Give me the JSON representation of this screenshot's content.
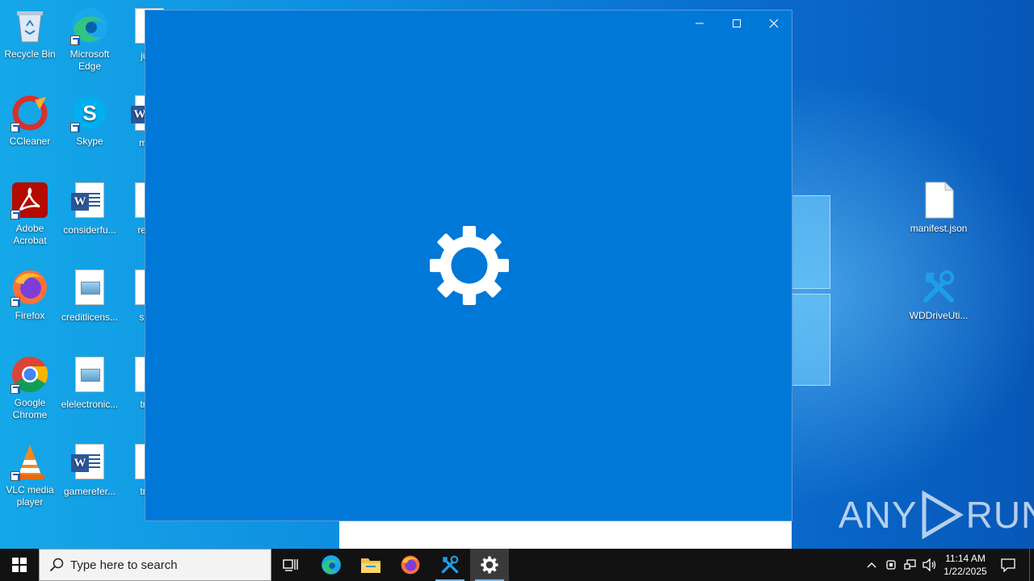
{
  "desktop": {
    "icons_left": [
      {
        "label": "Recycle Bin",
        "icon": "recycle-bin-icon"
      },
      {
        "label": "CCleaner",
        "icon": "ccleaner-icon"
      },
      {
        "label": "Adobe Acrobat",
        "icon": "acrobat-icon"
      },
      {
        "label": "Firefox",
        "icon": "firefox-icon"
      },
      {
        "label": "Google Chrome",
        "icon": "chrome-icon"
      },
      {
        "label": "VLC media player",
        "icon": "vlc-icon"
      }
    ],
    "icons_col2": [
      {
        "label": "Microsoft Edge",
        "icon": "edge-icon"
      },
      {
        "label": "Skype",
        "icon": "skype-icon"
      },
      {
        "label": "considerfu...",
        "icon": "word-doc-icon"
      },
      {
        "label": "creditlicens...",
        "icon": "image-file-icon"
      },
      {
        "label": "elelectronic...",
        "icon": "image-file-icon"
      },
      {
        "label": "gamerefer...",
        "icon": "word-doc-icon"
      }
    ],
    "icons_col3": [
      {
        "label": "julte"
      },
      {
        "label": "main"
      },
      {
        "label": "replie"
      },
      {
        "label": "suite"
      },
      {
        "label": "trialr"
      },
      {
        "label": "trust"
      }
    ],
    "icons_right": [
      {
        "label": "manifest.json",
        "icon": "json-file-icon"
      },
      {
        "label": "WDDriveUti...",
        "icon": "tools-icon"
      }
    ]
  },
  "window": {
    "minimize_icon": "minimize-icon",
    "maximize_icon": "maximize-icon",
    "close_icon": "close-icon",
    "splash_icon": "gear-icon",
    "background": "#0078d7"
  },
  "watermark": {
    "text_left": "ANY",
    "text_right": "RUN"
  },
  "taskbar": {
    "search_placeholder": "Type here to search",
    "clock_time": "11:14 AM",
    "clock_date": "1/22/2025",
    "accent": "#76b9ed"
  }
}
